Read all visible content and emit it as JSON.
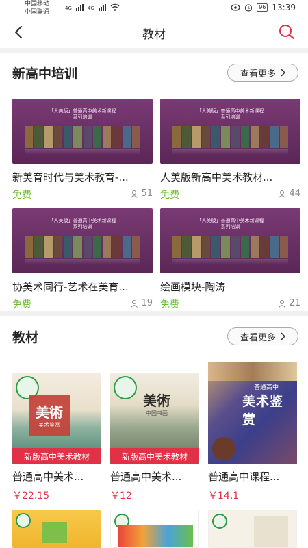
{
  "status_bar": {
    "carrier1": "中国移动",
    "carrier2": "中国联通",
    "net1": "4G",
    "net2": "4G",
    "battery": "96",
    "time": "13:39"
  },
  "nav": {
    "title": "教材"
  },
  "training": {
    "title": "新高中培训",
    "more": "查看更多",
    "cover_tag_line1": "「人美版」普通高中美术新课程",
    "cover_tag_line2": "系列培训",
    "items": [
      {
        "title": "新美育时代与美术教育-...",
        "price": "免费",
        "count": "51"
      },
      {
        "title": "人美版新高中美术教材...",
        "price": "免费",
        "count": "44"
      },
      {
        "title": "协美术同行-艺术在美育...",
        "price": "免费",
        "count": "19"
      },
      {
        "title": "绘画模块-陶涛",
        "price": "免费",
        "count": "21"
      }
    ]
  },
  "textbooks": {
    "title": "教材",
    "more": "查看更多",
    "items": [
      {
        "title": "普通高中美术...",
        "price": "￥22.15",
        "badge": "新版高中美术教材",
        "cover_text": "美術",
        "cover_sub": "美术鉴赏"
      },
      {
        "title": "普通高中美术...",
        "price": "￥12",
        "badge": "新版高中美术教材",
        "cover_text": "美術",
        "cover_sub": "中国书画"
      },
      {
        "title": "普通高中课程...",
        "price": "￥14.1",
        "badge": "",
        "cover_text": "美术鉴赏",
        "cover_sub": "普通高中"
      }
    ]
  },
  "colors": {
    "accent_red": "#e23146",
    "free_green": "#6abf2e",
    "cover_purple": "#6b2f66"
  }
}
